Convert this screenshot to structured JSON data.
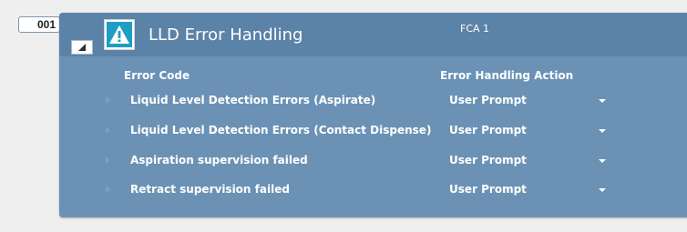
{
  "step": {
    "number": "001"
  },
  "panel": {
    "title": "LLD Error Handling",
    "subtitle": "FCA 1",
    "icon": "warning-icon",
    "colors": {
      "header": "#5b82a7",
      "body": "#6b92b5",
      "text": "#ffffff"
    }
  },
  "table": {
    "headers": {
      "code": "Error Code",
      "action": "Error Handling Action"
    },
    "rows": [
      {
        "code": "Liquid Level Detection Errors (Aspirate)",
        "action": "User Prompt"
      },
      {
        "code": "Liquid Level Detection Errors (Contact Dispense)",
        "action": "User Prompt"
      },
      {
        "code": "Aspiration supervision failed",
        "action": "User Prompt"
      },
      {
        "code": "Retract supervision failed",
        "action": "User Prompt"
      }
    ]
  }
}
